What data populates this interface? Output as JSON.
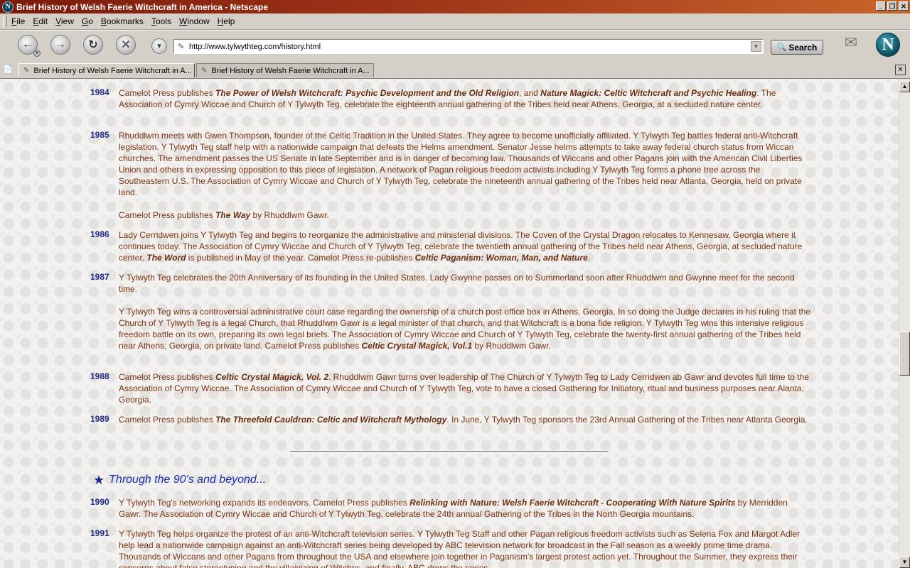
{
  "window": {
    "title": "Brief History of Welsh Faerie Witchcraft in America - Netscape",
    "buttons": {
      "minimize": "_",
      "maximize": "❐",
      "close": "✕"
    }
  },
  "menu": [
    "File",
    "Edit",
    "View",
    "Go",
    "Bookmarks",
    "Tools",
    "Window",
    "Help"
  ],
  "menu_access_keys": [
    "F",
    "E",
    "V",
    "G",
    "B",
    "T",
    "W",
    "H"
  ],
  "navbar": {
    "url": "http://www.tylwythteg.com/history.html",
    "search_label": "Search"
  },
  "tabs": [
    {
      "label": "Brief History of Welsh Faerie Witchcraft in A...",
      "selected": true
    },
    {
      "label": "Brief History of Welsh Faerie Witchcraft in A...",
      "selected": false
    }
  ],
  "icons": {
    "back": "back-arrow-icon",
    "forward": "forward-arrow-icon",
    "reload": "reload-icon",
    "stop": "stop-icon",
    "url_dropdown": "chevron-down-icon",
    "page": "page-icon",
    "search": "magnifier-icon",
    "mail": "mail-icon",
    "logo": "netscape-logo",
    "tab_close": "close-icon"
  },
  "colors": {
    "year": "#1e2a8a",
    "body_text": "#7a3410",
    "heading": "#1a2fb0",
    "titlebar": "#a03418"
  },
  "content": {
    "entries": [
      {
        "year": "1984",
        "paragraphs": [
          [
            {
              "t": "Camelot Press publishes "
            },
            {
              "t": "The Power of Welsh Witchcraft: Psychic Development and the Old Religion",
              "em": true
            },
            {
              "t": ", and "
            },
            {
              "t": "Nature Magick: Celtic Witchcraft and Psychic Healing",
              "em": true
            },
            {
              "t": ". The Association of Cymry Wiccae and Church of Y Tylwyth Teg, celebrate the eighteenth annual gathering of the Tribes held near Athens, Georgia, at a secluded nature center."
            }
          ]
        ]
      },
      {
        "year": "1985",
        "paragraphs": [
          [
            {
              "t": "Rhuddlwm meets with Gwen Thompson, founder of the Celtic Tradition in the United States. They agree to become unofficially affiliated. Y Tylwyth Teg battles federal anti-Witchcraft legislation. Y Tylwyth Teg staff help with a nationwide campaign that defeats the Helms amendment. Senator Jesse helms attempts to take away federal church status from Wiccan churches. The amendment passes the US Senate in late September and is in danger of becoming law. Thousands of Wiccans and other Pagans join with the American Civil Liberties Union and others in expressing opposition to this piece of legislation. A network of Pagan religious freedom activists including Y Tylwyth Teg forms a phone tree across the Southeastern U.S.  The Association of Cymry Wiccae and Church of Y Tylwyth Teg, celebrate the nineteenth annual gathering of the Tribes held near Atlanta, Georgia, held on private land."
            }
          ],
          [
            {
              "t": "Camelot Press publishes "
            },
            {
              "t": "The Way",
              "em": true
            },
            {
              "t": " by Rhuddlwm Gawr."
            }
          ]
        ]
      },
      {
        "year": "1986",
        "paragraphs": [
          [
            {
              "t": "Lady Cerridwen joins Y Tylwyth Teg and begins to reorganize the administrative and ministerial divisions. The Coven of the Crystal Dragon relocates to Kennesaw, Georgia where it continues today. The Association of Cymry Wiccae and Church of Y Tylwyth Teg, celebrate the twentieth annual gathering of the Tribes held near Athens, Georgia, at secluded nature center. "
            },
            {
              "t": "The Word",
              "em": true
            },
            {
              "t": " is published in May of the year.  Camelot Press re-publishes "
            },
            {
              "t": "Celtic Paganism: Woman, Man, and Nature",
              "em": true
            },
            {
              "t": "."
            }
          ]
        ]
      },
      {
        "year": "1987",
        "paragraphs": [
          [
            {
              "t": "Y Tylwyth Teg celebrates the 20th Anniversary of its founding in the United States.  Lady Gwynne passes on to Summerland soon after Rhuddlwm and Gwynne meet for the second time."
            }
          ],
          [
            {
              "t": "Y Tylwyth Teg wins a controversial administrative court case regarding the ownership of a church post office box in Athens, Georgia. In so doing the Judge declares in his ruling that the Church of Y Tylwyth Teg is a legal Church, that Rhuddlwm Gawr is a legal minister of that church, and that Witchcraft is a bona fide religion. Y Tylwyth Teg wins this intensive religious freedom battle on its own, preparing its own legal briefs.  The Association of Cymry Wiccae and Church of Y Tylwyth Teg, celebrate the twenty-first annual gathering of the Tribes held near Athens, Georgia, on private land.  Camelot Press publishes "
            },
            {
              "t": "Celtic Crystal Magick, Vol.1",
              "em": true
            },
            {
              "t": " by Rhuddlwm Gawr."
            }
          ]
        ]
      },
      {
        "year": "1988",
        "paragraphs": [
          [
            {
              "t": "Camelot Press publishes "
            },
            {
              "t": "Celtic Crystal Magick, Vol. 2",
              "em": true
            },
            {
              "t": ". Rhuddlwm Gawr turns over leadership of The Church of Y Tylwyth Teg to Lady Cerridwen ab Gawr and devotes full time to the Association of Cymry Wiccae.    The Association of Cymry Wiccae and Church of Y Tylwyth Teg, vote to have a closed Gathering for Initiatory, ritual and business purposes near Alanta, Georgia."
            }
          ]
        ]
      },
      {
        "year": "1989",
        "paragraphs": [
          [
            {
              "t": "Camelot Press publishes "
            },
            {
              "t": "The Threefold Cauldron: Celtic and Witchcraft Mythology",
              "em": true
            },
            {
              "t": ".  In June, Y Tylwyth Teg sponsors the 23rd Annual Gathering of the Tribes near Atlanta Georgia."
            }
          ]
        ]
      }
    ],
    "section_heading": "Through the 90's and beyond...",
    "entries_90s": [
      {
        "year": "1990",
        "paragraphs": [
          [
            {
              "t": "Y Tylwyth Teg's networking expands its endeavors. Camelot Press publishes "
            },
            {
              "t": "Relinking with Nature: Welsh Faerie Witchcraft - Cooperating With Nature Spirits",
              "em": true
            },
            {
              "t": " by Merridden Gawr.  The Association of Cymry Wiccae and Church of Y Tylwyth Teg, celebrate the 24th annual Gathering of the Tribes in the North Georgia mountains."
            }
          ]
        ]
      },
      {
        "year": "1991",
        "paragraphs": [
          [
            {
              "t": "Y Tylwyth Teg helps organize the protest of an anti-Witchcraft television series. Y Tylwyth Teg Staff and other Pagan religious freedom activists such as Selena Fox and Margot Adler help lead a nationwide campaign against an anti-Witchcraft series being developed by ABC television network for broadcast in the Fall season as a weekly prime time drama. Thousands of Wiccans and other Pagans from throughout the USA and elsewhere join together in Paganism's largest protest action yet. Throughout the Summer, they express their concerns about false stereotyping and the villainizing of Witches, and finally, ABC drops the series."
            }
          ]
        ]
      }
    ]
  }
}
